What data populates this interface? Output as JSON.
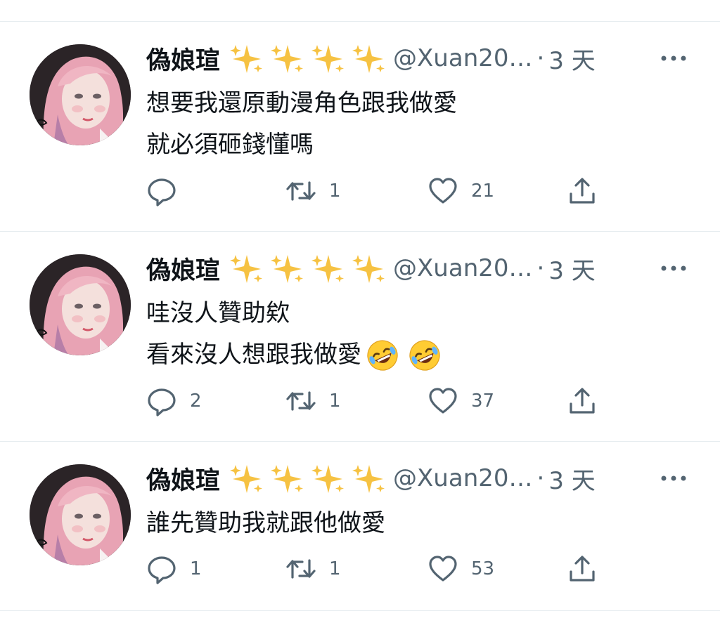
{
  "tweets": [
    {
      "name": "偽娘瑄",
      "handle": "@Xuan20…",
      "separator": "·",
      "time": "3 天",
      "lines": [
        "想要我還原動漫角色跟我做愛",
        "就必須砸錢懂嗎"
      ],
      "replies": "",
      "retweets": "1",
      "likes": "21"
    },
    {
      "name": "偽娘瑄",
      "handle": "@Xuan20…",
      "separator": "·",
      "time": "3 天",
      "lines": [
        "哇沒人贊助欸",
        "看來沒人想跟我做愛"
      ],
      "replies": "2",
      "retweets": "1",
      "likes": "37"
    },
    {
      "name": "偽娘瑄",
      "handle": "@Xuan20…",
      "separator": "·",
      "time": "3 天",
      "lines": [
        "誰先贊助我就跟他做愛"
      ],
      "replies": "1",
      "retweets": "1",
      "likes": "53"
    }
  ],
  "icons": {
    "name_emoji": "sparkles-icon",
    "laugh_emoji": "rolling-on-floor-laughing-icon",
    "reply": "reply-icon",
    "retweet": "retweet-icon",
    "like": "heart-icon",
    "share": "share-icon",
    "more": "more-icon"
  },
  "colors": {
    "text_primary": "#0f1419",
    "text_secondary": "#536471",
    "divider": "#e6ecf0",
    "sparkle": "#f6c242"
  }
}
